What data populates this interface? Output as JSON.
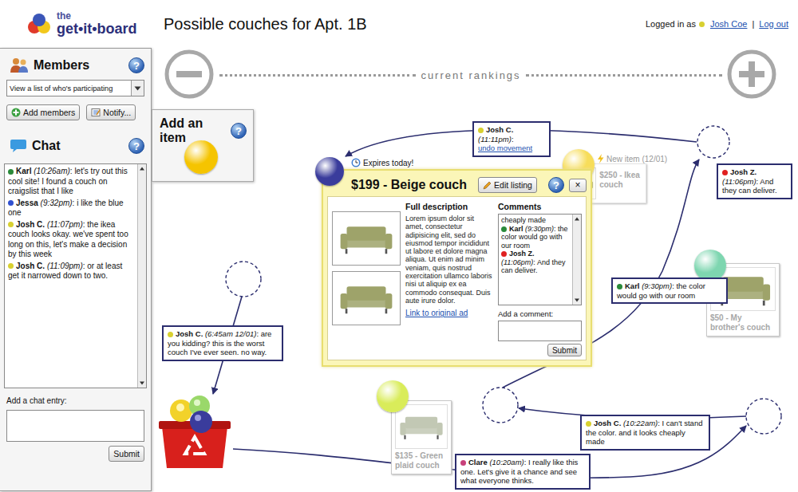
{
  "header": {
    "logo_small": "the",
    "logo_main": "get•it•board",
    "title": "Possible couches for Apt. 1B",
    "login_prefix": "Logged in as",
    "user": {
      "name": "Josh Coe",
      "color": "#d8d030"
    },
    "separator": "|",
    "logout": "Log out"
  },
  "members": {
    "title": "Members",
    "help": "?",
    "dropdown": "View a list of who's participating",
    "buttons": [
      "Add members",
      "Notify..."
    ]
  },
  "chat": {
    "title": "Chat",
    "help": "?",
    "messages": [
      {
        "author": "Karl",
        "time": "(10:26am)",
        "colon": ":",
        "text": "let's try out this cool site! I found a couch on craigslist that I like",
        "color": "#2a8a3a"
      },
      {
        "author": "Jessa",
        "time": "(9:32pm)",
        "colon": ":",
        "text": "i like the blue one",
        "color": "#3050d0"
      },
      {
        "author": "Josh C.",
        "time": "(11:07pm)",
        "colon": ":",
        "text": "the ikea couch looks okay. we've spent too long on this, let's make a decision by this week",
        "color": "#d8d030"
      },
      {
        "author": "Josh C.",
        "time": "(11:09pm)",
        "colon": ":",
        "text": "or at least get it narrowed down to two.",
        "color": "#d8d030"
      }
    ],
    "input_label": "Add a chat entry:",
    "submit": "Submit"
  },
  "add_item": {
    "label": "Add an item",
    "help": "?"
  },
  "rankings": {
    "label": "current rankings"
  },
  "items": [
    {
      "label": "$250 - Ikea couch",
      "badge": "New item (12/01)",
      "color": "#f7dd5a",
      "kind": "new"
    },
    {
      "label": "$50 - My brother's couch",
      "color": "#7ed6b0",
      "kind": "listed"
    },
    {
      "label": "$135 - Green plaid couch",
      "color": "#d9ec5a",
      "kind": "listed"
    }
  ],
  "popup": {
    "expires": "Expires today!",
    "title": "$199 - Beige couch",
    "color": "#3a3c9c",
    "edit": "Edit listing",
    "help": "?",
    "close": "×",
    "description_title": "Full description",
    "description": "Lorem ipsum dolor sit amet, consectetur adipisicing elit, sed do eiusmod tempor incididunt ut labore et dolore magna aliqua. Ut enim ad minim veniam, quis nostrud exercitation ullamco laboris nisi ut aliquip ex ea commodo consequat. Duis aute irure dolor.",
    "link": "Link to original ad",
    "comments_title": "Comments",
    "comments_partial": "cheaply made",
    "comments": [
      {
        "author": "Karl",
        "time": "(9:30pm)",
        "colon": ":",
        "text": "the color would go with our room",
        "color": "#2a8a3a"
      },
      {
        "author": "Josh Z.",
        "time": "(11:06pm)",
        "colon": ":",
        "text": "And they can deliver.",
        "color": "#e02020"
      }
    ],
    "comment_label": "Add a comment:",
    "submit": "Submit"
  },
  "annotations": [
    {
      "author": "Josh C.",
      "time": "(11:11pm)",
      "colon": ":",
      "text": "undo movement",
      "color": "#d8d030",
      "kind": "link"
    },
    {
      "author": "Josh Z.",
      "time": "(11:06pm)",
      "colon": ":",
      "text": "And they can deliver.",
      "color": "#e02020",
      "kind": "note"
    },
    {
      "author": "Karl",
      "time": "(9:30pm)",
      "colon": ":",
      "text": "the color would go with our room",
      "color": "#2a8a3a",
      "kind": "note"
    },
    {
      "author": "Josh C.",
      "time": "(6:45am 12/01)",
      "colon": ":",
      "text": "are you kidding? this is the worst couch I've ever seen. no way.",
      "color": "#d8d030",
      "kind": "note"
    },
    {
      "author": "Josh C.",
      "time": "(10:22am)",
      "colon": ":",
      "text": "I can't stand the color. and it looks cheaply made",
      "color": "#d8d030",
      "kind": "note"
    },
    {
      "author": "Clare",
      "time": "(10:20am)",
      "colon": ":",
      "text": "I really like this one. Let's give it a chance and see what everyone thinks.",
      "color": "#c8407a",
      "kind": "note"
    }
  ]
}
